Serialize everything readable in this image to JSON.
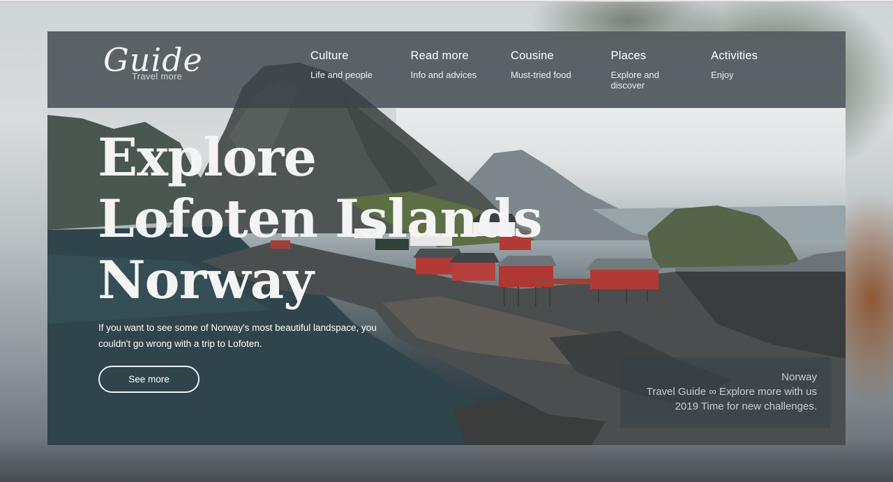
{
  "brand": {
    "logo_text": "Guide",
    "tagline": "Travel more"
  },
  "nav": {
    "items": [
      {
        "title": "Culture",
        "subtitle": "Life and people"
      },
      {
        "title": "Read more",
        "subtitle": "Info and advices"
      },
      {
        "title": "Cousine",
        "subtitle": "Must-tried food"
      },
      {
        "title": "Places",
        "subtitle": "Explore and discover"
      },
      {
        "title": "Activities",
        "subtitle": "Enjoy"
      }
    ]
  },
  "hero": {
    "headline_lines": [
      "Explore",
      "Lofoten Islands",
      "Norway"
    ],
    "lead": "If you want to see some of Norway's most beautiful landspace, you couldn't go wrong with a trip to Lofoten.",
    "cta_label": "See more"
  },
  "caption": {
    "lines": [
      "Norway",
      "Travel Guide ∞ Explore more with us",
      "2019 Time for new challenges."
    ]
  },
  "colors": {
    "navbar_bg": "#3a4248",
    "text_light": "#f4f4f4",
    "caption_text": "#c9ced1",
    "house_red": "#b23a36"
  }
}
